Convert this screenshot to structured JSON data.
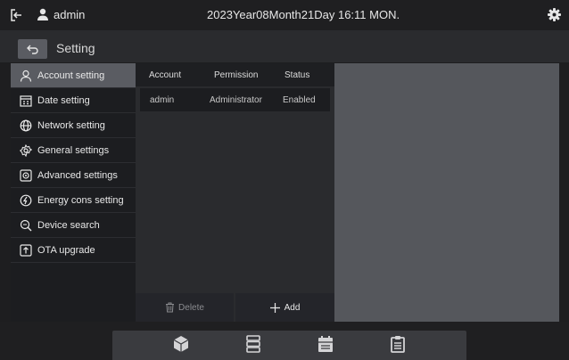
{
  "topbar": {
    "user": "admin",
    "datetime": "2023Year08Month21Day 16:11 MON."
  },
  "subbar": {
    "title": "Setting"
  },
  "sidebar": {
    "items": [
      {
        "label": "Account setting",
        "icon": "user-icon",
        "active": true
      },
      {
        "label": "Date setting",
        "icon": "calendar-icon"
      },
      {
        "label": "Network setting",
        "icon": "globe-icon"
      },
      {
        "label": "General settings",
        "icon": "gear-icon"
      },
      {
        "label": "Advanced settings",
        "icon": "advanced-icon"
      },
      {
        "label": "Energy cons setting",
        "icon": "energy-icon"
      },
      {
        "label": "Device search",
        "icon": "device-search-icon"
      },
      {
        "label": "OTA upgrade",
        "icon": "upload-icon"
      }
    ]
  },
  "table": {
    "headers": [
      "Account",
      "Permission",
      "Status"
    ],
    "rows": [
      [
        "admin",
        "Administrator",
        "Enabled"
      ]
    ]
  },
  "actions": {
    "delete": "Delete",
    "add": "Add"
  },
  "dock": {
    "icons": [
      "cube-icon",
      "server-icon",
      "calendar-icon",
      "clipboard-icon"
    ]
  },
  "colors": {
    "active": "#5a5c62",
    "panel": "#55575c",
    "background": "#1e1e20"
  }
}
